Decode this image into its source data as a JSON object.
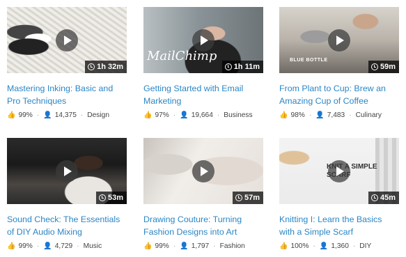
{
  "courses": [
    {
      "title": "Mastering Inking: Basic and Pro Techniques",
      "duration": "1h 32m",
      "rating": "99%",
      "students": "14,375",
      "category": "Design"
    },
    {
      "title": "Getting Started with Email Marketing",
      "duration": "1h 11m",
      "rating": "97%",
      "students": "19,664",
      "category": "Business",
      "thumb_text": "MailChimp"
    },
    {
      "title": "From Plant to Cup: Brew an Amazing Cup of Coffee",
      "duration": "59m",
      "rating": "98%",
      "students": "7,483",
      "category": "Culinary",
      "thumb_text": "BLUE BOTTLE"
    },
    {
      "title": "Sound Check: The Essentials of DIY Audio Mixing",
      "duration": "53m",
      "rating": "99%",
      "students": "4,729",
      "category": "Music"
    },
    {
      "title": "Drawing Couture: Turning Fashion Designs into Art",
      "duration": "57m",
      "rating": "99%",
      "students": "1,797",
      "category": "Fashion"
    },
    {
      "title": "Knitting I: Learn the Basics with a Simple Scarf",
      "duration": "45m",
      "rating": "100%",
      "students": "1,360",
      "category": "DIY",
      "thumb_text": "KNIT A SIMPLE SCARF"
    }
  ],
  "icons": {
    "play": "play-icon",
    "clock": "clock-icon",
    "thumbs_up": "thumb-up-icon",
    "person": "person-icon"
  },
  "colors": {
    "title_link": "#2b86c5",
    "meta_text": "#444444"
  }
}
